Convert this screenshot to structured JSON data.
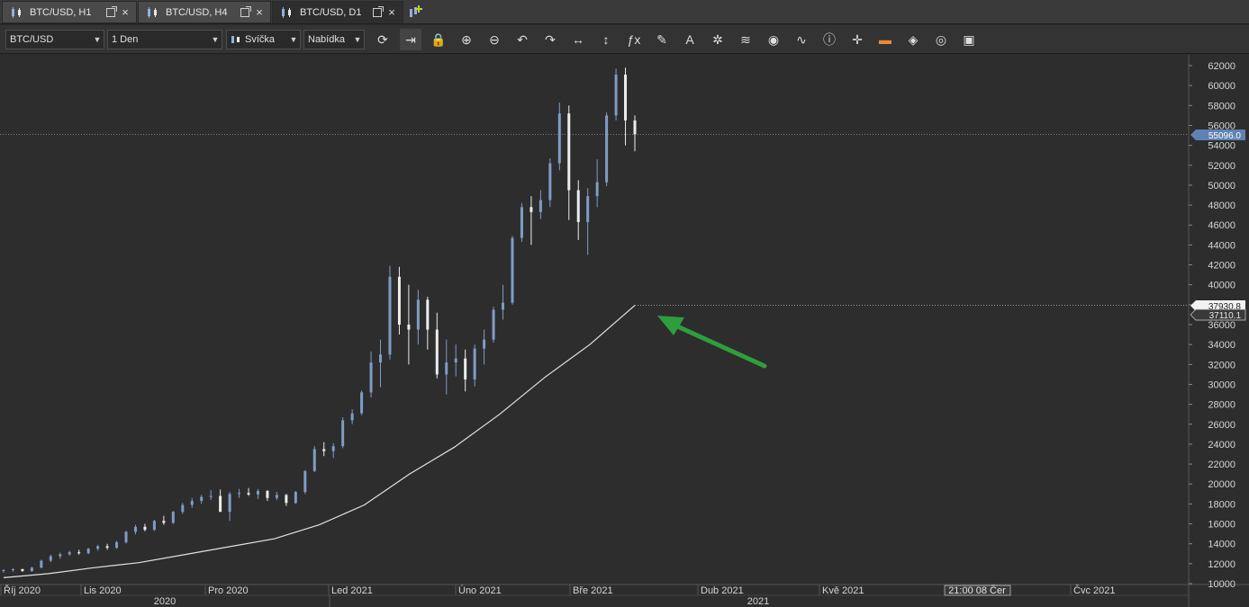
{
  "tabs": [
    {
      "label": "BTC/USD, H1",
      "active": false
    },
    {
      "label": "BTC/USD, H4",
      "active": false
    },
    {
      "label": "BTC/USD, D1",
      "active": true
    }
  ],
  "toolbar": {
    "symbol": "BTC/USD",
    "timeframe": "1 Den",
    "chart_type": "Svíčka",
    "price_side": "Nabídka",
    "icons": [
      "refresh-icon",
      "autoscroll-icon",
      "lock-icon",
      "zoom-in-icon",
      "zoom-out-icon",
      "undo-icon",
      "redo-icon",
      "horizontal-arrows-icon",
      "vertical-arrows-icon",
      "fx-indicators-icon",
      "pencil-icon",
      "text-tool-icon",
      "magic-icon",
      "layers-icon",
      "eye-icon",
      "chart-pattern-icon",
      "info-icon",
      "crosshair-icon",
      "color-bar-icon",
      "paint-bucket-icon",
      "settings-ring-icon",
      "save-icon"
    ]
  },
  "chart_data": {
    "type": "candlestick",
    "timeframe": "D1",
    "price_axis": {
      "ticks": [
        "62000",
        "60000",
        "58000",
        "56000",
        "54000",
        "52000",
        "50000",
        "48000",
        "46000",
        "44000",
        "42000",
        "40000",
        "38000",
        "36000",
        "34000",
        "32000",
        "30000",
        "28000",
        "26000",
        "24000",
        "22000",
        "20000",
        "18000",
        "16000",
        "14000",
        "12000",
        "10000"
      ],
      "min": 10000,
      "max": 62000
    },
    "time_axis": {
      "months": [
        "Říj 2020",
        "Lis 2020",
        "Pro 2020",
        "Led 2021",
        "Úno 2021",
        "Bře 2021",
        "Dub 2021",
        "Kvě 2021",
        "Čvc 2021"
      ],
      "crosshair_label": "21:00 08 Čer",
      "years": [
        "2020",
        "2021"
      ]
    },
    "price_labels": {
      "current": "55096.0",
      "ma_level": "37930.8",
      "ma_other": "37110.1"
    },
    "current_price": 55096,
    "ma_last": 37930.8,
    "ma_other": 37110.1,
    "ma_series": [
      10600,
      11000,
      11600,
      12100,
      12900,
      13700,
      14500,
      15900,
      17900,
      21000,
      23700,
      27000,
      30700,
      34000,
      37930.8
    ],
    "candles": [
      [
        11300,
        11450,
        11100,
        11350
      ],
      [
        11350,
        11550,
        11200,
        11450
      ],
      [
        11450,
        11500,
        11200,
        11250
      ],
      [
        11250,
        11700,
        11200,
        11600
      ],
      [
        11600,
        12400,
        11550,
        12300
      ],
      [
        12300,
        12900,
        12150,
        12750
      ],
      [
        12750,
        13100,
        12500,
        12950
      ],
      [
        12950,
        13300,
        12800,
        13150
      ],
      [
        13150,
        13400,
        12900,
        13050
      ],
      [
        13050,
        13600,
        12950,
        13500
      ],
      [
        13500,
        13900,
        13300,
        13750
      ],
      [
        13750,
        14000,
        13400,
        13600
      ],
      [
        13600,
        14300,
        13500,
        14150
      ],
      [
        14150,
        15300,
        14000,
        15200
      ],
      [
        15200,
        15900,
        14950,
        15700
      ],
      [
        15700,
        16000,
        15250,
        15400
      ],
      [
        15400,
        16400,
        15300,
        16300
      ],
      [
        16300,
        16800,
        15900,
        16100
      ],
      [
        16100,
        17300,
        16000,
        17200
      ],
      [
        17200,
        18100,
        17000,
        17900
      ],
      [
        17900,
        18600,
        17600,
        18300
      ],
      [
        18300,
        18900,
        18000,
        18700
      ],
      [
        18700,
        19400,
        18400,
        18800
      ],
      [
        18800,
        19450,
        17600,
        17200
      ],
      [
        17200,
        19200,
        16300,
        19000
      ],
      [
        19000,
        19500,
        18600,
        19100
      ],
      [
        19100,
        19600,
        18800,
        18950
      ],
      [
        18950,
        19500,
        18500,
        19300
      ],
      [
        19300,
        19400,
        18300,
        18600
      ],
      [
        18600,
        19200,
        18400,
        18900
      ],
      [
        18900,
        19000,
        17800,
        18100
      ],
      [
        18100,
        19300,
        18000,
        19200
      ],
      [
        19200,
        21400,
        19000,
        21300
      ],
      [
        21300,
        23800,
        21200,
        23500
      ],
      [
        23500,
        24200,
        22800,
        23300
      ],
      [
        23300,
        24100,
        22600,
        23800
      ],
      [
        23800,
        26700,
        23600,
        26400
      ],
      [
        26400,
        27500,
        26000,
        27100
      ],
      [
        27100,
        29400,
        26900,
        29200
      ],
      [
        29200,
        33300,
        28700,
        32200
      ],
      [
        32200,
        34500,
        29700,
        33000
      ],
      [
        33000,
        41900,
        32500,
        40800
      ],
      [
        40800,
        41800,
        35000,
        36000
      ],
      [
        36000,
        40000,
        32000,
        35500
      ],
      [
        35500,
        39500,
        34000,
        38500
      ],
      [
        38500,
        38800,
        33500,
        35500
      ],
      [
        35500,
        37200,
        30600,
        31000
      ],
      [
        31000,
        34500,
        29000,
        32200
      ],
      [
        32200,
        34000,
        30800,
        32600
      ],
      [
        32600,
        33500,
        29300,
        30500
      ],
      [
        30500,
        34000,
        29800,
        33600
      ],
      [
        33600,
        35500,
        32000,
        34500
      ],
      [
        34500,
        37800,
        34200,
        37500
      ],
      [
        37500,
        40000,
        36500,
        38200
      ],
      [
        38200,
        44900,
        38000,
        44700
      ],
      [
        44700,
        48200,
        44300,
        47800
      ],
      [
        47800,
        48900,
        44000,
        47300
      ],
      [
        47300,
        49500,
        46600,
        48500
      ],
      [
        48500,
        52700,
        47800,
        52200
      ],
      [
        52200,
        58300,
        51500,
        57200
      ],
      [
        57200,
        58000,
        46500,
        49500
      ],
      [
        49500,
        50500,
        44500,
        46300
      ],
      [
        46300,
        49700,
        43000,
        48900
      ],
      [
        48900,
        52600,
        47800,
        50300
      ],
      [
        50300,
        57300,
        49900,
        57000
      ],
      [
        57000,
        61700,
        56500,
        61100
      ],
      [
        61100,
        61800,
        54000,
        56500
      ],
      [
        56500,
        57000,
        53400,
        55096
      ]
    ]
  }
}
